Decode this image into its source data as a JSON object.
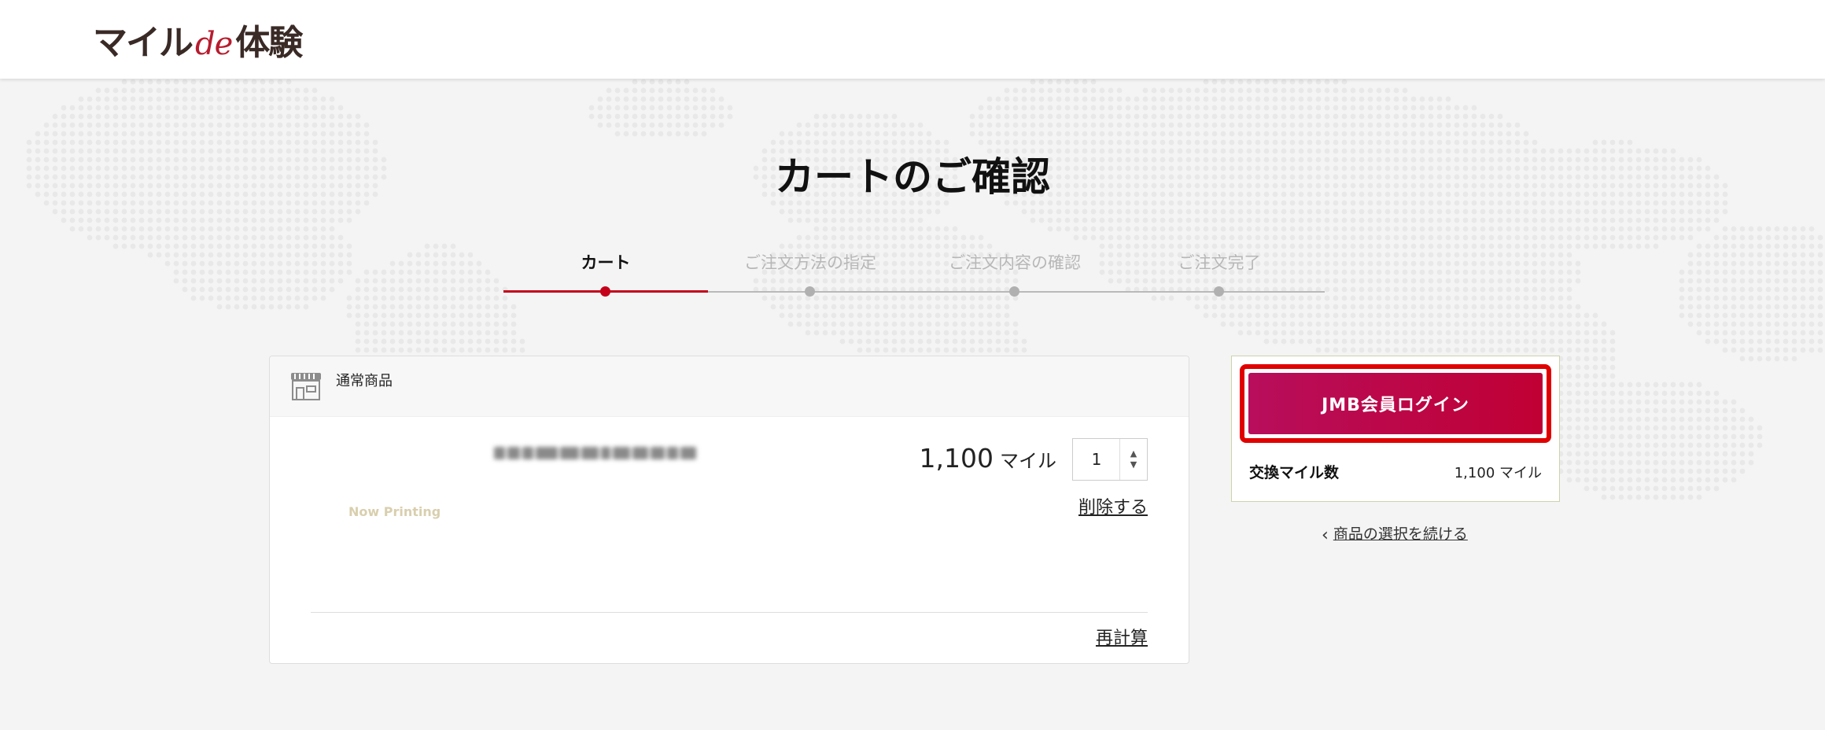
{
  "header": {
    "logo_part1": "マイル",
    "logo_part2": "de",
    "logo_part3": "体験"
  },
  "page_title": "カートのご確認",
  "stepper": {
    "steps": [
      {
        "label": "カート",
        "active": true
      },
      {
        "label": "ご注文方法の指定",
        "active": false
      },
      {
        "label": "ご注文内容の確認",
        "active": false
      },
      {
        "label": "ご注文完了",
        "active": false
      }
    ]
  },
  "cart": {
    "section_label": "通常商品",
    "item": {
      "thumbnail_text": "Now Printing",
      "miles": "1,100",
      "miles_unit": "マイル",
      "quantity": "1",
      "delete_label": "削除する"
    },
    "recalc_label": "再計算"
  },
  "summary": {
    "login_button": "JMB会員ログイン",
    "exchange_label": "交換マイル数",
    "exchange_value": "1,100 マイル"
  },
  "continue_link": "商品の選択を続ける",
  "colors": {
    "accent": "#c4001a",
    "login_gradient_start": "#b80e5c",
    "login_gradient_end": "#c00034",
    "highlight": "#e00000"
  }
}
